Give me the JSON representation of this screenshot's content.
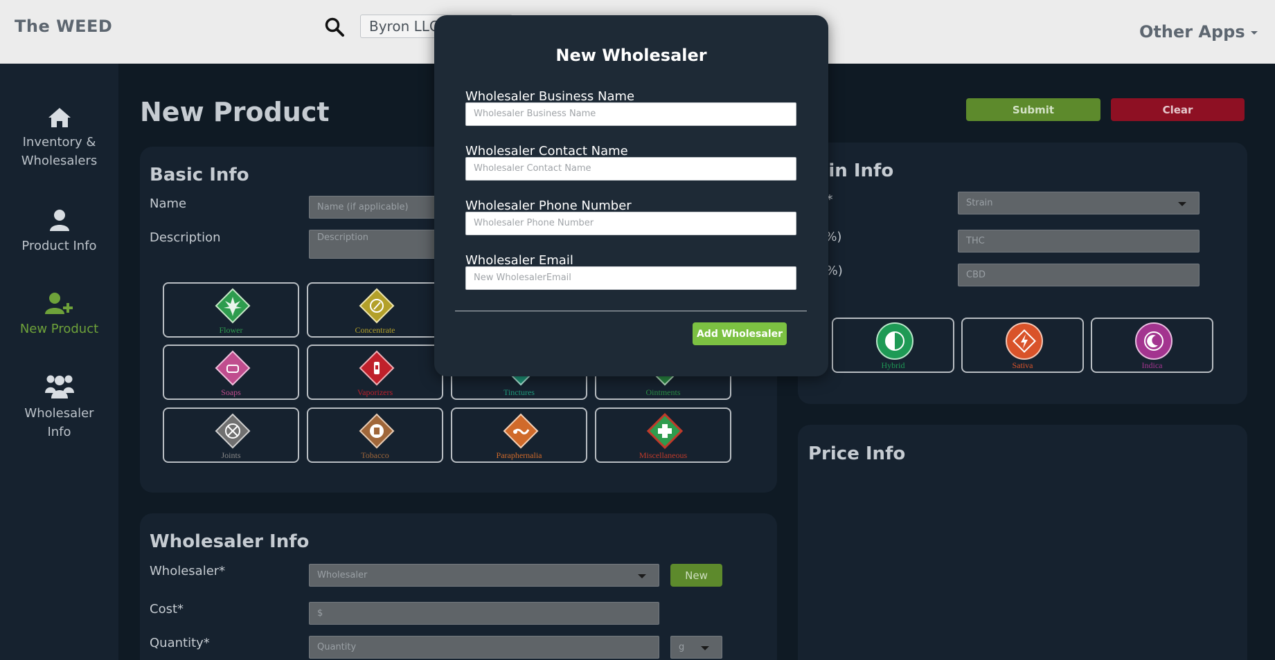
{
  "header": {
    "brand": "The WEED",
    "search_value": "Byron LLC",
    "other_apps": "Other Apps"
  },
  "sidebar": {
    "items": [
      {
        "line1": "Inventory &",
        "line2": "Wholesalers"
      },
      {
        "line1": "Product Info",
        "line2": ""
      },
      {
        "line1": "New Product",
        "line2": ""
      },
      {
        "line1": "Wholesaler",
        "line2": "Info"
      }
    ]
  },
  "main": {
    "title": "New Product",
    "submit": "Submit",
    "clear": "Clear"
  },
  "basic_info": {
    "title": "Basic Info",
    "name_label": "Name",
    "name_placeholder": "Name (if applicable)",
    "description_label": "Description",
    "description_placeholder": "Description",
    "categories": [
      {
        "label": "Flower",
        "color": "#2e9c4e"
      },
      {
        "label": "Concentrate",
        "color": "#b3a02a"
      },
      {
        "label": "Soaps",
        "color": "#c04d8e"
      },
      {
        "label": "Vaporizers",
        "color": "#c0202b"
      },
      {
        "label": "Tinctures",
        "color": "#1f9a7c"
      },
      {
        "label": "Ointments",
        "color": "#2b8d45"
      },
      {
        "label": "Joints",
        "color": "#707070"
      },
      {
        "label": "Tobacco",
        "color": "#a0673a"
      },
      {
        "label": "Paraphernalia",
        "color": "#d06a2a"
      },
      {
        "label": "Miscellaneous",
        "color": "#c03a2a"
      }
    ]
  },
  "strain_info": {
    "title": "rain Info",
    "strain_label": "ain*",
    "strain_placeholder": "Strain",
    "thc_label": "C (%)",
    "thc_placeholder": "THC",
    "cbd_label": "D (%)",
    "cbd_placeholder": "CBD",
    "types": [
      {
        "label": "Hybrid",
        "color": "#1e9a55"
      },
      {
        "label": "Sativa",
        "color": "#d9532a"
      },
      {
        "label": "Indica",
        "color": "#a3348f"
      }
    ]
  },
  "price_info": {
    "title": "Price Info"
  },
  "wholesaler_info": {
    "title": "Wholesaler Info",
    "wholesaler_label": "Wholesaler*",
    "wholesaler_placeholder": "Wholesaler",
    "new_button": "New",
    "cost_label": "Cost*",
    "cost_placeholder": "$",
    "quantity_label": "Quantity*",
    "quantity_placeholder": "Quantity",
    "unit_value": "g"
  },
  "modal": {
    "title": "New Wholesaler",
    "business_label": "Wholesaler Business Name",
    "business_placeholder": "Wholesaler Business Name",
    "contact_label": "Wholesaler Contact Name",
    "contact_placeholder": "Wholesaler Contact Name",
    "phone_label": "Wholesaler Phone Number",
    "phone_placeholder": "Wholesaler Phone Number",
    "email_label": "Wholesaler Email",
    "email_placeholder": "New WholesalerEmail",
    "add_button": "Add Wholesaler"
  }
}
